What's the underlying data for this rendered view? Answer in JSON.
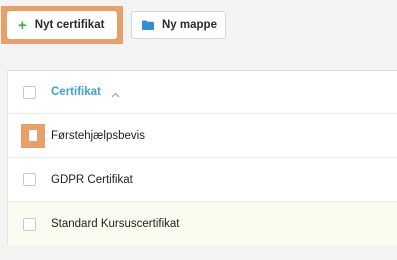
{
  "toolbar": {
    "new_certificate_label": "Nyt certifikat",
    "new_folder_label": "Ny mappe"
  },
  "table": {
    "header": "Certifikat",
    "rows": [
      {
        "name": "Førstehjælpsbevis"
      },
      {
        "name": "GDPR Certifikat"
      },
      {
        "name": "Standard Kursuscertifikat"
      }
    ]
  },
  "colors": {
    "accent_blue": "#3aa0e0",
    "plus_green": "#39b54a",
    "highlight_orange": "#e8a06a",
    "row_highlight": "#fafcef"
  },
  "icons": {
    "new_certificate": "plus-icon",
    "new_folder": "folder-icon",
    "sort": "chevron-up-icon"
  }
}
